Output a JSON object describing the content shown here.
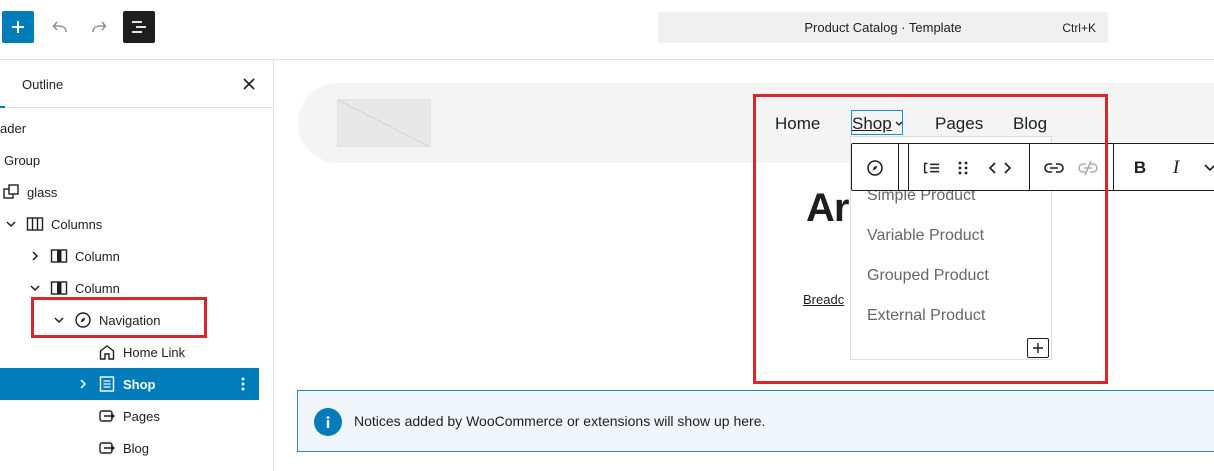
{
  "topbar": {
    "add_icon": "plus-icon",
    "undo_icon": "undo-icon",
    "redo_icon": "redo-icon",
    "outline_icon": "list-view-icon",
    "command_title": "Product Catalog · Template",
    "command_shortcut": "Ctrl+K"
  },
  "sidebar": {
    "tab_label": "Outline",
    "close_icon": "close-icon",
    "items": [
      {
        "label": "ader"
      },
      {
        "label": "Group"
      },
      {
        "label": "glass"
      },
      {
        "label": "Columns"
      },
      {
        "label": "Column"
      },
      {
        "label": "Column"
      },
      {
        "label": "Navigation"
      },
      {
        "label": "Home Link"
      },
      {
        "label": "Shop"
      },
      {
        "label": "Pages"
      },
      {
        "label": "Blog"
      }
    ]
  },
  "canvas": {
    "nav": {
      "home": "Home",
      "shop": "Shop",
      "pages": "Pages",
      "blog": "Blog"
    },
    "heading_partial": "Ar",
    "breadcrumb_partial": "Breadc",
    "submenu": [
      "Simple Product",
      "Variable Product",
      "Grouped Product",
      "External Product"
    ],
    "toolbar_italic": "I",
    "toolbar_bold": "B",
    "notice_text": "Notices added by WooCommerce or extensions will show up here."
  },
  "colors": {
    "accent": "#007cba",
    "highlight": "#d9262c",
    "notice_bg": "#f0f6fc"
  }
}
